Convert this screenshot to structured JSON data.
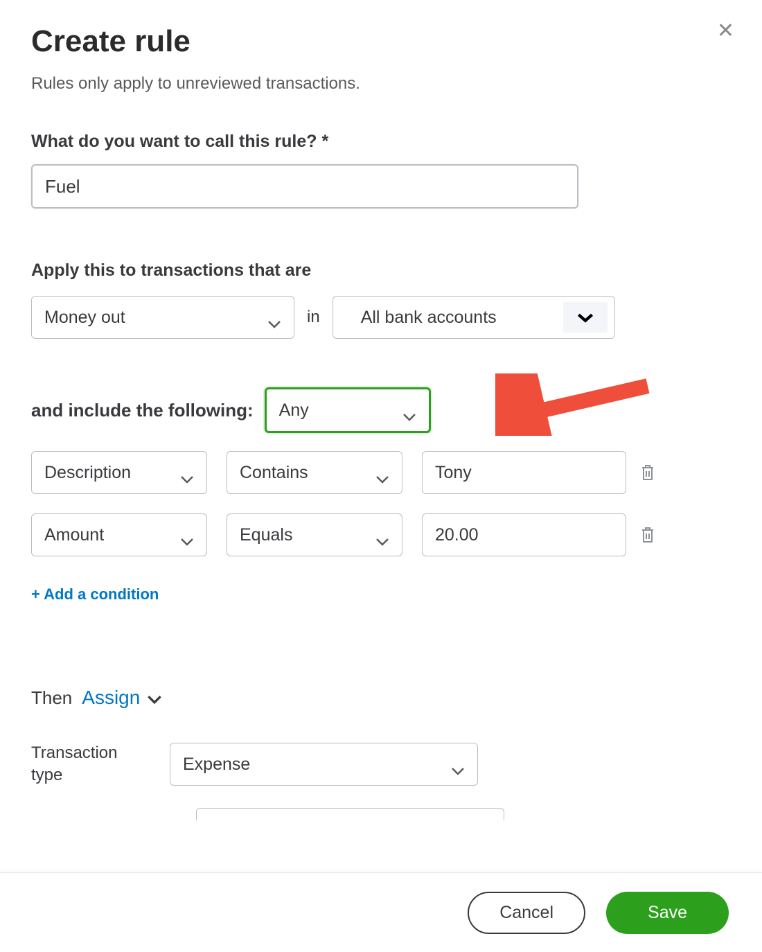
{
  "header": {
    "title": "Create rule",
    "subtitle": "Rules only apply to unreviewed transactions."
  },
  "rule_name": {
    "label": "What do you want to call this rule? *",
    "value": "Fuel"
  },
  "apply_to": {
    "label": "Apply this to transactions that are",
    "direction": "Money out",
    "connector": "in",
    "account": "All bank accounts"
  },
  "include": {
    "label": "and include the following:",
    "mode": "Any"
  },
  "conditions": [
    {
      "field": "Description",
      "operator": "Contains",
      "value": "Tony"
    },
    {
      "field": "Amount",
      "operator": "Equals",
      "value": "20.00"
    }
  ],
  "add_condition_label": "+ Add a condition",
  "then": {
    "label": "Then",
    "action": "Assign",
    "transaction_type_label": "Transaction type",
    "transaction_type_value": "Expense"
  },
  "footer": {
    "cancel": "Cancel",
    "save": "Save"
  }
}
